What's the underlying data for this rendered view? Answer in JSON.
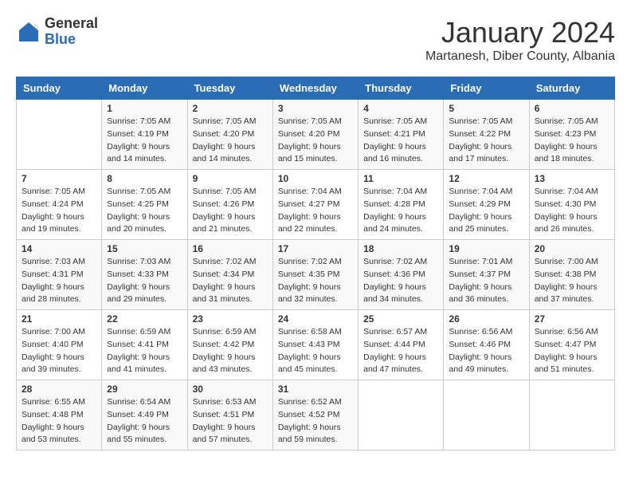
{
  "logo": {
    "general": "General",
    "blue": "Blue"
  },
  "header": {
    "month": "January 2024",
    "location": "Martanesh, Diber County, Albania"
  },
  "weekdays": [
    "Sunday",
    "Monday",
    "Tuesday",
    "Wednesday",
    "Thursday",
    "Friday",
    "Saturday"
  ],
  "weeks": [
    [
      {
        "day": "",
        "sunrise": "",
        "sunset": "",
        "daylight": ""
      },
      {
        "day": "1",
        "sunrise": "Sunrise: 7:05 AM",
        "sunset": "Sunset: 4:19 PM",
        "daylight": "Daylight: 9 hours and 14 minutes."
      },
      {
        "day": "2",
        "sunrise": "Sunrise: 7:05 AM",
        "sunset": "Sunset: 4:20 PM",
        "daylight": "Daylight: 9 hours and 14 minutes."
      },
      {
        "day": "3",
        "sunrise": "Sunrise: 7:05 AM",
        "sunset": "Sunset: 4:20 PM",
        "daylight": "Daylight: 9 hours and 15 minutes."
      },
      {
        "day": "4",
        "sunrise": "Sunrise: 7:05 AM",
        "sunset": "Sunset: 4:21 PM",
        "daylight": "Daylight: 9 hours and 16 minutes."
      },
      {
        "day": "5",
        "sunrise": "Sunrise: 7:05 AM",
        "sunset": "Sunset: 4:22 PM",
        "daylight": "Daylight: 9 hours and 17 minutes."
      },
      {
        "day": "6",
        "sunrise": "Sunrise: 7:05 AM",
        "sunset": "Sunset: 4:23 PM",
        "daylight": "Daylight: 9 hours and 18 minutes."
      }
    ],
    [
      {
        "day": "7",
        "sunrise": "Sunrise: 7:05 AM",
        "sunset": "Sunset: 4:24 PM",
        "daylight": "Daylight: 9 hours and 19 minutes."
      },
      {
        "day": "8",
        "sunrise": "Sunrise: 7:05 AM",
        "sunset": "Sunset: 4:25 PM",
        "daylight": "Daylight: 9 hours and 20 minutes."
      },
      {
        "day": "9",
        "sunrise": "Sunrise: 7:05 AM",
        "sunset": "Sunset: 4:26 PM",
        "daylight": "Daylight: 9 hours and 21 minutes."
      },
      {
        "day": "10",
        "sunrise": "Sunrise: 7:04 AM",
        "sunset": "Sunset: 4:27 PM",
        "daylight": "Daylight: 9 hours and 22 minutes."
      },
      {
        "day": "11",
        "sunrise": "Sunrise: 7:04 AM",
        "sunset": "Sunset: 4:28 PM",
        "daylight": "Daylight: 9 hours and 24 minutes."
      },
      {
        "day": "12",
        "sunrise": "Sunrise: 7:04 AM",
        "sunset": "Sunset: 4:29 PM",
        "daylight": "Daylight: 9 hours and 25 minutes."
      },
      {
        "day": "13",
        "sunrise": "Sunrise: 7:04 AM",
        "sunset": "Sunset: 4:30 PM",
        "daylight": "Daylight: 9 hours and 26 minutes."
      }
    ],
    [
      {
        "day": "14",
        "sunrise": "Sunrise: 7:03 AM",
        "sunset": "Sunset: 4:31 PM",
        "daylight": "Daylight: 9 hours and 28 minutes."
      },
      {
        "day": "15",
        "sunrise": "Sunrise: 7:03 AM",
        "sunset": "Sunset: 4:33 PM",
        "daylight": "Daylight: 9 hours and 29 minutes."
      },
      {
        "day": "16",
        "sunrise": "Sunrise: 7:02 AM",
        "sunset": "Sunset: 4:34 PM",
        "daylight": "Daylight: 9 hours and 31 minutes."
      },
      {
        "day": "17",
        "sunrise": "Sunrise: 7:02 AM",
        "sunset": "Sunset: 4:35 PM",
        "daylight": "Daylight: 9 hours and 32 minutes."
      },
      {
        "day": "18",
        "sunrise": "Sunrise: 7:02 AM",
        "sunset": "Sunset: 4:36 PM",
        "daylight": "Daylight: 9 hours and 34 minutes."
      },
      {
        "day": "19",
        "sunrise": "Sunrise: 7:01 AM",
        "sunset": "Sunset: 4:37 PM",
        "daylight": "Daylight: 9 hours and 36 minutes."
      },
      {
        "day": "20",
        "sunrise": "Sunrise: 7:00 AM",
        "sunset": "Sunset: 4:38 PM",
        "daylight": "Daylight: 9 hours and 37 minutes."
      }
    ],
    [
      {
        "day": "21",
        "sunrise": "Sunrise: 7:00 AM",
        "sunset": "Sunset: 4:40 PM",
        "daylight": "Daylight: 9 hours and 39 minutes."
      },
      {
        "day": "22",
        "sunrise": "Sunrise: 6:59 AM",
        "sunset": "Sunset: 4:41 PM",
        "daylight": "Daylight: 9 hours and 41 minutes."
      },
      {
        "day": "23",
        "sunrise": "Sunrise: 6:59 AM",
        "sunset": "Sunset: 4:42 PM",
        "daylight": "Daylight: 9 hours and 43 minutes."
      },
      {
        "day": "24",
        "sunrise": "Sunrise: 6:58 AM",
        "sunset": "Sunset: 4:43 PM",
        "daylight": "Daylight: 9 hours and 45 minutes."
      },
      {
        "day": "25",
        "sunrise": "Sunrise: 6:57 AM",
        "sunset": "Sunset: 4:44 PM",
        "daylight": "Daylight: 9 hours and 47 minutes."
      },
      {
        "day": "26",
        "sunrise": "Sunrise: 6:56 AM",
        "sunset": "Sunset: 4:46 PM",
        "daylight": "Daylight: 9 hours and 49 minutes."
      },
      {
        "day": "27",
        "sunrise": "Sunrise: 6:56 AM",
        "sunset": "Sunset: 4:47 PM",
        "daylight": "Daylight: 9 hours and 51 minutes."
      }
    ],
    [
      {
        "day": "28",
        "sunrise": "Sunrise: 6:55 AM",
        "sunset": "Sunset: 4:48 PM",
        "daylight": "Daylight: 9 hours and 53 minutes."
      },
      {
        "day": "29",
        "sunrise": "Sunrise: 6:54 AM",
        "sunset": "Sunset: 4:49 PM",
        "daylight": "Daylight: 9 hours and 55 minutes."
      },
      {
        "day": "30",
        "sunrise": "Sunrise: 6:53 AM",
        "sunset": "Sunset: 4:51 PM",
        "daylight": "Daylight: 9 hours and 57 minutes."
      },
      {
        "day": "31",
        "sunrise": "Sunrise: 6:52 AM",
        "sunset": "Sunset: 4:52 PM",
        "daylight": "Daylight: 9 hours and 59 minutes."
      },
      {
        "day": "",
        "sunrise": "",
        "sunset": "",
        "daylight": ""
      },
      {
        "day": "",
        "sunrise": "",
        "sunset": "",
        "daylight": ""
      },
      {
        "day": "",
        "sunrise": "",
        "sunset": "",
        "daylight": ""
      }
    ]
  ]
}
